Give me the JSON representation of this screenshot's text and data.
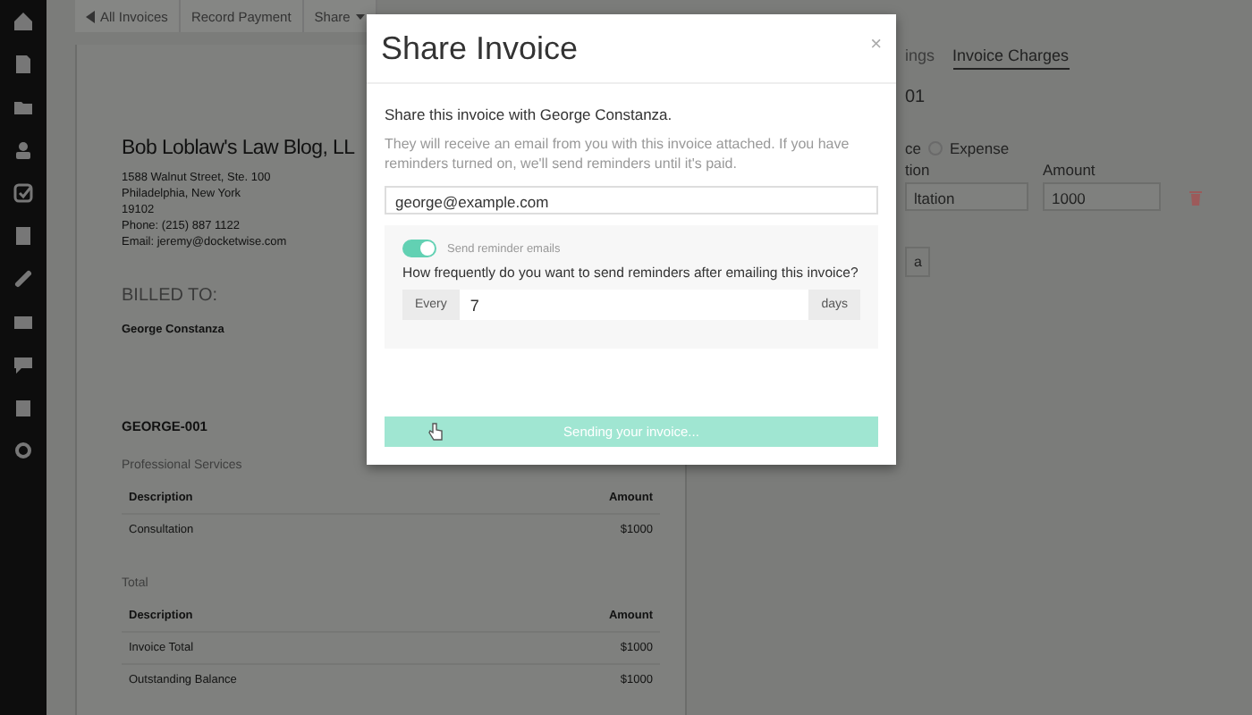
{
  "toolbar": {
    "buttons": [
      {
        "label": "All Invoices",
        "kind": "back"
      },
      {
        "label": "Record Payment",
        "kind": "plain"
      },
      {
        "label": "Share",
        "kind": "dropdown"
      }
    ]
  },
  "invoice": {
    "firm_name": "Bob Loblaw's Law Blog, LL",
    "address_lines": [
      "1588 Walnut Street, Ste. 100",
      "Philadelphia, New York",
      "19102",
      "Phone: (215) 887 1122",
      "Email: jeremy@docketwise.com"
    ],
    "billed_to_label": "BILLED TO:",
    "client": "George Constanza",
    "invoice_number": "GEORGE-001",
    "sections": [
      {
        "title": "Professional Services",
        "columns": [
          "Description",
          "Amount"
        ],
        "rows": [
          {
            "description": "Consultation",
            "amount": "$1000"
          }
        ]
      },
      {
        "title": "Total",
        "columns": [
          "Description",
          "Amount"
        ],
        "rows": [
          {
            "description": "Invoice Total",
            "amount": "$1000"
          },
          {
            "description": "Outstanding Balance",
            "amount": "$1000"
          }
        ]
      }
    ]
  },
  "right_panel": {
    "tabs": [
      {
        "label": "ings",
        "selected": false
      },
      {
        "label": "Invoice Charges",
        "selected": true
      }
    ],
    "heading": "01",
    "type_fragment": "ce",
    "expense_option": {
      "label": "Expense",
      "selected": false
    },
    "description_label": "tion",
    "amount_label": "Amount",
    "description_value": "ltation",
    "amount_value": "1000",
    "add_button": "a"
  },
  "modal": {
    "title": "Share Invoice",
    "close": "×",
    "intro": "Share this invoice with George Constanza.",
    "note": "They will receive an email from you with this invoice attached. If you have reminders turned on, we'll send reminders until it's paid.",
    "email": "george@example.com",
    "reminder": {
      "on": true,
      "label": "Send reminder emails",
      "question": "How frequently do you want to send reminders after emailing this invoice?",
      "prefix": "Every",
      "value": "7",
      "suffix": "days"
    },
    "submit": {
      "label": "Sending your invoice...",
      "disabled": true
    }
  }
}
